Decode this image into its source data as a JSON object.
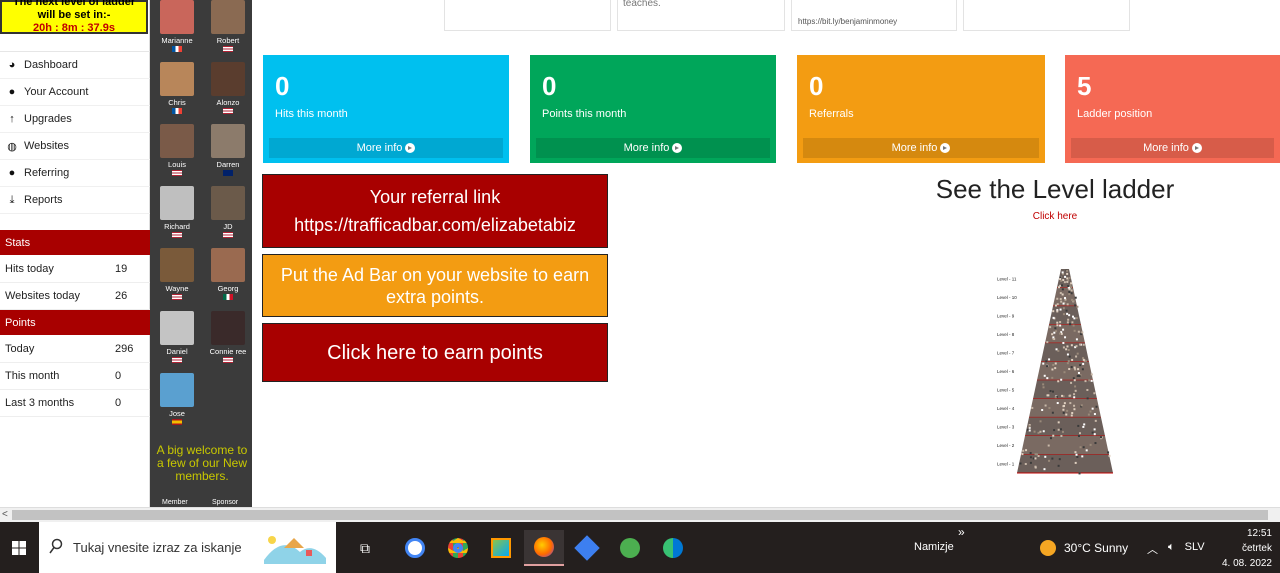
{
  "timer": {
    "line1": "The next level of ladder",
    "line2": "will be set in:-",
    "time": "20h : 8m : 37.9s"
  },
  "nav": [
    {
      "label": "Dashboard",
      "icon": "dashboard-icon"
    },
    {
      "label": "Your Account",
      "icon": "user-icon"
    },
    {
      "label": "Upgrades",
      "icon": "upgrade-icon"
    },
    {
      "label": "Websites",
      "icon": "globe-icon"
    },
    {
      "label": "Referring",
      "icon": "users-icon"
    },
    {
      "label": "Reports",
      "icon": "download-icon"
    }
  ],
  "stats": {
    "head": "Stats",
    "rows": [
      {
        "k": "Hits today",
        "v": "19"
      },
      {
        "k": "Websites today",
        "v": "26"
      }
    ]
  },
  "points": {
    "head": "Points",
    "rows": [
      {
        "k": "Today",
        "v": "296"
      },
      {
        "k": "This month",
        "v": "0"
      },
      {
        "k": "Last 3 months",
        "v": "0"
      }
    ]
  },
  "members": [
    {
      "name": "Marianne",
      "flag": "fr"
    },
    {
      "name": "Robert",
      "flag": "us"
    },
    {
      "name": "Chris",
      "flag": "fr"
    },
    {
      "name": "Alonzo",
      "flag": "us"
    },
    {
      "name": "Louis",
      "flag": "us"
    },
    {
      "name": "Darren",
      "flag": "gb"
    },
    {
      "name": "Richard",
      "flag": "us"
    },
    {
      "name": "JD",
      "flag": "us"
    },
    {
      "name": "Wayne",
      "flag": "us"
    },
    {
      "name": "Georg",
      "flag": "mx"
    },
    {
      "name": "Daniel",
      "flag": "us"
    },
    {
      "name": "Connie ree",
      "flag": "us"
    },
    {
      "name": "Jose",
      "flag": "es"
    }
  ],
  "welcome": "A big welcome to a few of our New members.",
  "member_head": "Member",
  "sponsor_head": "Sponsor",
  "top_cards": {
    "teaches": "teaches.",
    "link": "https://bit.ly/benjaminmoney"
  },
  "boxes": [
    {
      "num": "0",
      "label": "Hits this month",
      "more": "More info",
      "color": "#00c0ef"
    },
    {
      "num": "0",
      "label": "Points this month",
      "more": "More info",
      "color": "#00a65a"
    },
    {
      "num": "0",
      "label": "Referrals",
      "more": "More info",
      "color": "#f39c12"
    },
    {
      "num": "5",
      "label": "Ladder position",
      "more": "More info",
      "color": "#f56954"
    }
  ],
  "cta": {
    "referral_title": "Your referral link",
    "referral_url": "https://trafficadbar.com/elizabetabiz",
    "adbar": "Put the Ad Bar on your website to earn extra points.",
    "earn": "Click here to earn points"
  },
  "ladder": {
    "title": "See the Level ladder",
    "link": "Click here",
    "levels": [
      "Level - 11",
      "Level - 10",
      "Level - 9",
      "Level - 8",
      "Level - 7",
      "Level - 6",
      "Level - 5",
      "Level - 4",
      "Level - 3",
      "Level - 2",
      "Level - 1"
    ]
  },
  "taskbar": {
    "search_placeholder": "Tukaj vnesite izraz za iskanje",
    "namizje": "Namizje",
    "weather": "30°C  Sunny",
    "lang": "SLV",
    "time": "12:51",
    "day": "četrtek",
    "date": "4. 08. 2022"
  },
  "colors": {
    "red": "#a80000",
    "orange": "#f39c12",
    "yellow": "#ffff00"
  }
}
